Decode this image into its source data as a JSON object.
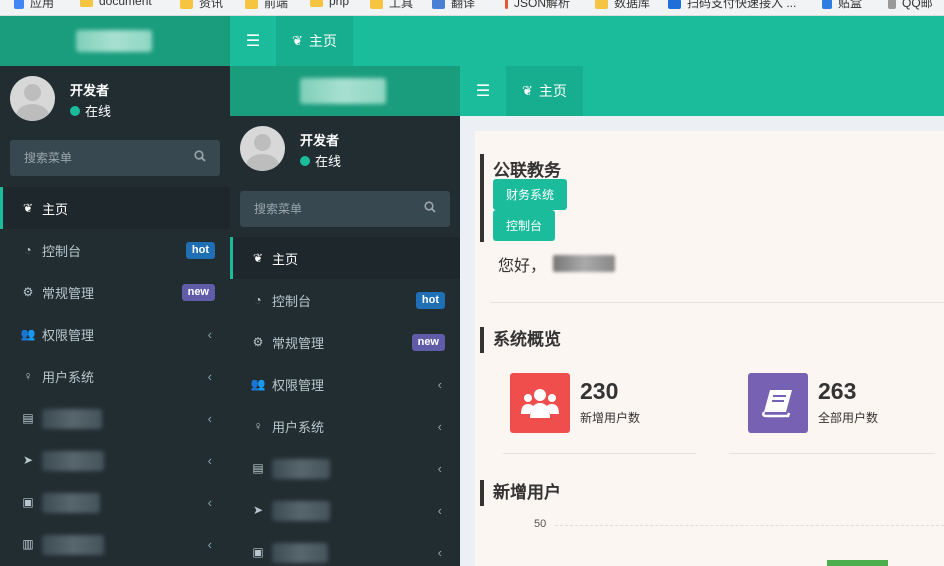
{
  "bookmarks": [
    {
      "label": "应用"
    },
    {
      "label": "document"
    },
    {
      "label": "资讯"
    },
    {
      "label": "前端"
    },
    {
      "label": "php"
    },
    {
      "label": "工具"
    },
    {
      "label": "翻译"
    },
    {
      "label": "JSON解析"
    },
    {
      "label": "数据库"
    },
    {
      "label": "扫码支付快速接入 ..."
    },
    {
      "label": "贴盒"
    },
    {
      "label": "QQ邮"
    }
  ],
  "topbar": {
    "home_label": "主页"
  },
  "user": {
    "name": "开发者",
    "status": "在线"
  },
  "search": {
    "placeholder": "搜索菜单"
  },
  "menu": {
    "items": [
      {
        "label": "主页",
        "icon": "leaf-icon"
      },
      {
        "label": "控制台",
        "icon": "dashboard-icon",
        "badge": "hot"
      },
      {
        "label": "常规管理",
        "icon": "cogs-icon",
        "badge": "new"
      },
      {
        "label": "权限管理",
        "icon": "users-icon"
      },
      {
        "label": "用户系统",
        "icon": "user-icon"
      }
    ],
    "chevron": "‹"
  },
  "content": {
    "org_title": "公联教务",
    "buttons": [
      "财务系统",
      "控制台"
    ],
    "greeting": "您好，",
    "overview_title": "系统概览",
    "stats": [
      {
        "value": "230",
        "label": "新增用户数",
        "color": "#f04d4d",
        "icon": "users-icon"
      },
      {
        "value": "263",
        "label": "全部用户数",
        "color": "#7761b2",
        "icon": "book-icon"
      }
    ],
    "new_users_title": "新增用户",
    "axis_tick": "50"
  },
  "colors": {
    "accent": "#1abc9c",
    "sidebar": "#222d32",
    "hot": "#1f6fb5",
    "new": "#605ca8"
  }
}
